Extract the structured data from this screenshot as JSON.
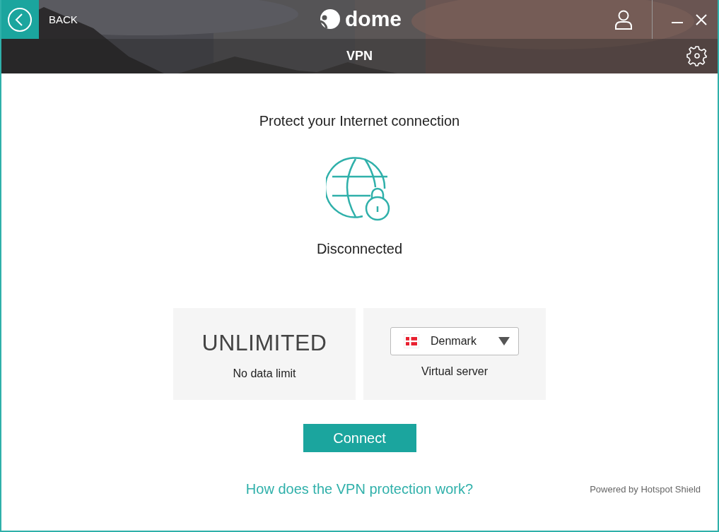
{
  "header": {
    "back_label": "BACK",
    "logo": "dome",
    "section_title": "VPN"
  },
  "main": {
    "heading": "Protect your Internet connection",
    "status": "Disconnected",
    "connected": false
  },
  "cards": [
    {
      "kind": "plan",
      "value": "UNLIMITED",
      "caption": "No data limit"
    },
    {
      "kind": "server",
      "country": "Denmark",
      "caption": "Virtual server"
    }
  ],
  "connect_button": "Connect",
  "help_link": "How does the VPN protection work?",
  "footer": {
    "powered_by": "Powered by Hotspot Shield"
  }
}
